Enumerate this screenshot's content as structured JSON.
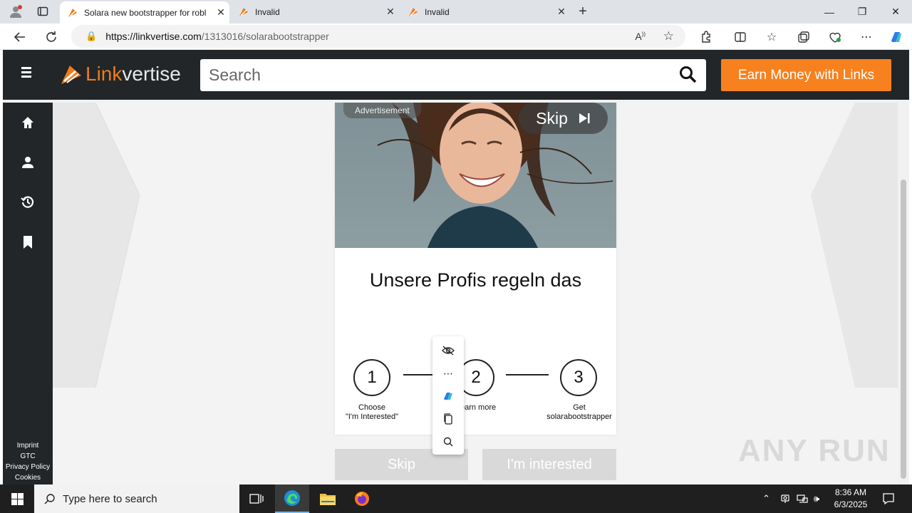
{
  "browser": {
    "tabs": [
      {
        "title": "Solara new bootstrapper for robl",
        "active": true
      },
      {
        "title": "Invalid",
        "active": false
      },
      {
        "title": "Invalid",
        "active": false
      }
    ],
    "url_main": "https://linkvertise.com",
    "url_rest": "/1313016/solarabootstrapper"
  },
  "site": {
    "logo_part1": "Link",
    "logo_part2": "vertise",
    "search_placeholder": "Search",
    "earn_button": "Earn Money with Links",
    "footer_links": [
      "Imprint",
      "GTC",
      "Privacy Policy",
      "Cookies"
    ]
  },
  "ad": {
    "label": "Advertisement",
    "skip_label": "Skip",
    "headline": "Unsere Profis regeln das",
    "steps": [
      {
        "number": "1",
        "text_line1": "Choose",
        "text_line2": "\"I'm Interested\""
      },
      {
        "number": "2",
        "text_line1": "Learn more",
        "text_line2": ""
      },
      {
        "number": "3",
        "text_line1": "Get",
        "text_line2": "solarabootstrapper"
      }
    ],
    "skip_button": "Skip",
    "interested_button": "I'm interested"
  },
  "watermark": "ANY RUN",
  "taskbar": {
    "search_placeholder": "Type here to search",
    "time": "8:36 AM",
    "date": "6/3/2025"
  },
  "colors": {
    "brand_orange": "#f7811e",
    "header_dark": "#222629",
    "taskbar": "#1f1f1f"
  }
}
